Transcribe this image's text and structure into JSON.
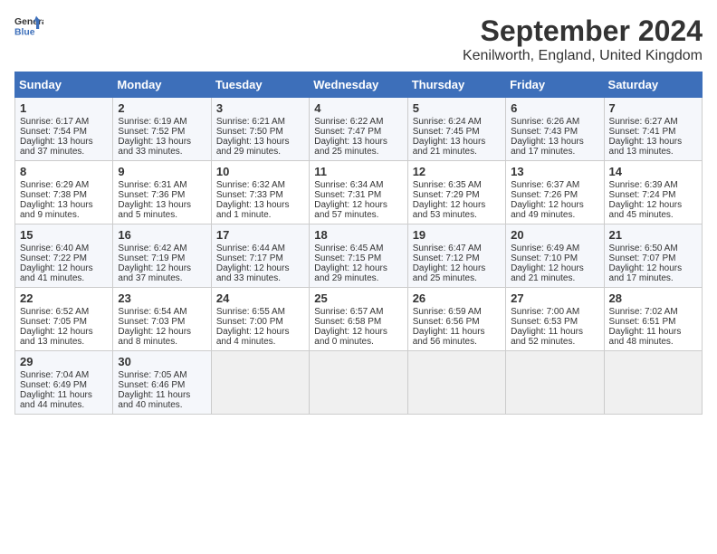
{
  "header": {
    "logo_line1": "General",
    "logo_line2": "Blue",
    "title": "September 2024",
    "subtitle": "Kenilworth, England, United Kingdom"
  },
  "weekdays": [
    "Sunday",
    "Monday",
    "Tuesday",
    "Wednesday",
    "Thursday",
    "Friday",
    "Saturday"
  ],
  "weeks": [
    [
      {
        "day": "1",
        "lines": [
          "Sunrise: 6:17 AM",
          "Sunset: 7:54 PM",
          "Daylight: 13 hours",
          "and 37 minutes."
        ]
      },
      {
        "day": "2",
        "lines": [
          "Sunrise: 6:19 AM",
          "Sunset: 7:52 PM",
          "Daylight: 13 hours",
          "and 33 minutes."
        ]
      },
      {
        "day": "3",
        "lines": [
          "Sunrise: 6:21 AM",
          "Sunset: 7:50 PM",
          "Daylight: 13 hours",
          "and 29 minutes."
        ]
      },
      {
        "day": "4",
        "lines": [
          "Sunrise: 6:22 AM",
          "Sunset: 7:47 PM",
          "Daylight: 13 hours",
          "and 25 minutes."
        ]
      },
      {
        "day": "5",
        "lines": [
          "Sunrise: 6:24 AM",
          "Sunset: 7:45 PM",
          "Daylight: 13 hours",
          "and 21 minutes."
        ]
      },
      {
        "day": "6",
        "lines": [
          "Sunrise: 6:26 AM",
          "Sunset: 7:43 PM",
          "Daylight: 13 hours",
          "and 17 minutes."
        ]
      },
      {
        "day": "7",
        "lines": [
          "Sunrise: 6:27 AM",
          "Sunset: 7:41 PM",
          "Daylight: 13 hours",
          "and 13 minutes."
        ]
      }
    ],
    [
      {
        "day": "8",
        "lines": [
          "Sunrise: 6:29 AM",
          "Sunset: 7:38 PM",
          "Daylight: 13 hours",
          "and 9 minutes."
        ]
      },
      {
        "day": "9",
        "lines": [
          "Sunrise: 6:31 AM",
          "Sunset: 7:36 PM",
          "Daylight: 13 hours",
          "and 5 minutes."
        ]
      },
      {
        "day": "10",
        "lines": [
          "Sunrise: 6:32 AM",
          "Sunset: 7:33 PM",
          "Daylight: 13 hours",
          "and 1 minute."
        ]
      },
      {
        "day": "11",
        "lines": [
          "Sunrise: 6:34 AM",
          "Sunset: 7:31 PM",
          "Daylight: 12 hours",
          "and 57 minutes."
        ]
      },
      {
        "day": "12",
        "lines": [
          "Sunrise: 6:35 AM",
          "Sunset: 7:29 PM",
          "Daylight: 12 hours",
          "and 53 minutes."
        ]
      },
      {
        "day": "13",
        "lines": [
          "Sunrise: 6:37 AM",
          "Sunset: 7:26 PM",
          "Daylight: 12 hours",
          "and 49 minutes."
        ]
      },
      {
        "day": "14",
        "lines": [
          "Sunrise: 6:39 AM",
          "Sunset: 7:24 PM",
          "Daylight: 12 hours",
          "and 45 minutes."
        ]
      }
    ],
    [
      {
        "day": "15",
        "lines": [
          "Sunrise: 6:40 AM",
          "Sunset: 7:22 PM",
          "Daylight: 12 hours",
          "and 41 minutes."
        ]
      },
      {
        "day": "16",
        "lines": [
          "Sunrise: 6:42 AM",
          "Sunset: 7:19 PM",
          "Daylight: 12 hours",
          "and 37 minutes."
        ]
      },
      {
        "day": "17",
        "lines": [
          "Sunrise: 6:44 AM",
          "Sunset: 7:17 PM",
          "Daylight: 12 hours",
          "and 33 minutes."
        ]
      },
      {
        "day": "18",
        "lines": [
          "Sunrise: 6:45 AM",
          "Sunset: 7:15 PM",
          "Daylight: 12 hours",
          "and 29 minutes."
        ]
      },
      {
        "day": "19",
        "lines": [
          "Sunrise: 6:47 AM",
          "Sunset: 7:12 PM",
          "Daylight: 12 hours",
          "and 25 minutes."
        ]
      },
      {
        "day": "20",
        "lines": [
          "Sunrise: 6:49 AM",
          "Sunset: 7:10 PM",
          "Daylight: 12 hours",
          "and 21 minutes."
        ]
      },
      {
        "day": "21",
        "lines": [
          "Sunrise: 6:50 AM",
          "Sunset: 7:07 PM",
          "Daylight: 12 hours",
          "and 17 minutes."
        ]
      }
    ],
    [
      {
        "day": "22",
        "lines": [
          "Sunrise: 6:52 AM",
          "Sunset: 7:05 PM",
          "Daylight: 12 hours",
          "and 13 minutes."
        ]
      },
      {
        "day": "23",
        "lines": [
          "Sunrise: 6:54 AM",
          "Sunset: 7:03 PM",
          "Daylight: 12 hours",
          "and 8 minutes."
        ]
      },
      {
        "day": "24",
        "lines": [
          "Sunrise: 6:55 AM",
          "Sunset: 7:00 PM",
          "Daylight: 12 hours",
          "and 4 minutes."
        ]
      },
      {
        "day": "25",
        "lines": [
          "Sunrise: 6:57 AM",
          "Sunset: 6:58 PM",
          "Daylight: 12 hours",
          "and 0 minutes."
        ]
      },
      {
        "day": "26",
        "lines": [
          "Sunrise: 6:59 AM",
          "Sunset: 6:56 PM",
          "Daylight: 11 hours",
          "and 56 minutes."
        ]
      },
      {
        "day": "27",
        "lines": [
          "Sunrise: 7:00 AM",
          "Sunset: 6:53 PM",
          "Daylight: 11 hours",
          "and 52 minutes."
        ]
      },
      {
        "day": "28",
        "lines": [
          "Sunrise: 7:02 AM",
          "Sunset: 6:51 PM",
          "Daylight: 11 hours",
          "and 48 minutes."
        ]
      }
    ],
    [
      {
        "day": "29",
        "lines": [
          "Sunrise: 7:04 AM",
          "Sunset: 6:49 PM",
          "Daylight: 11 hours",
          "and 44 minutes."
        ]
      },
      {
        "day": "30",
        "lines": [
          "Sunrise: 7:05 AM",
          "Sunset: 6:46 PM",
          "Daylight: 11 hours",
          "and 40 minutes."
        ]
      },
      {
        "day": "",
        "lines": []
      },
      {
        "day": "",
        "lines": []
      },
      {
        "day": "",
        "lines": []
      },
      {
        "day": "",
        "lines": []
      },
      {
        "day": "",
        "lines": []
      }
    ]
  ]
}
